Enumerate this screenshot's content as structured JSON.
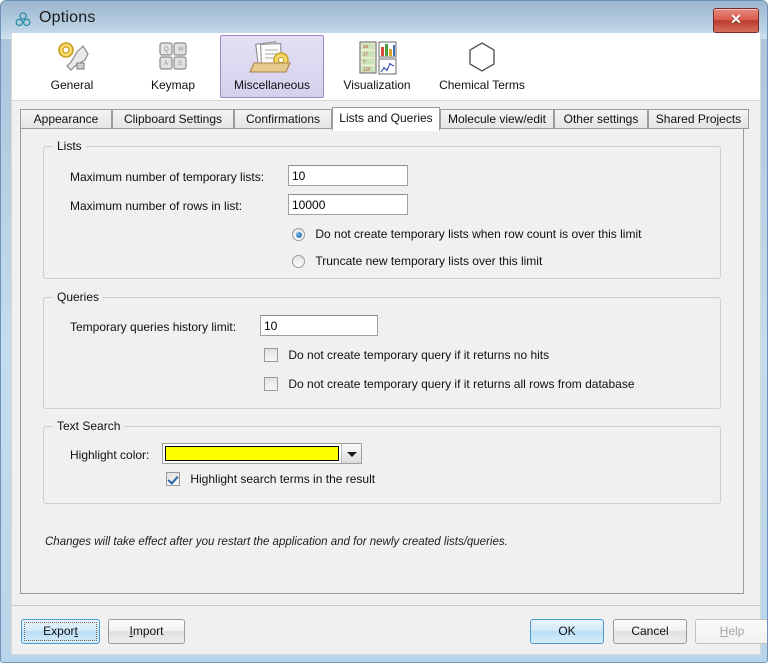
{
  "window": {
    "title": "Options",
    "title_icon": "molecule-icon",
    "close_label": "✕"
  },
  "toolbar": {
    "items": [
      {
        "label": "General",
        "icon": "gear-wrench-icon",
        "selected": false
      },
      {
        "label": "Keymap",
        "icon": "keyboard-keys-icon",
        "selected": false
      },
      {
        "label": "Miscellaneous",
        "icon": "documents-gear-icon",
        "selected": true
      },
      {
        "label": "Visualization",
        "icon": "charts-icon",
        "selected": false
      },
      {
        "label": "Chemical Terms",
        "icon": "benzene-ring-icon",
        "selected": false
      }
    ]
  },
  "tabs": [
    {
      "label": "Appearance",
      "active": false
    },
    {
      "label": "Clipboard Settings",
      "active": false
    },
    {
      "label": "Confirmations",
      "active": false
    },
    {
      "label": "Lists and Queries",
      "active": true
    },
    {
      "label": "Molecule view/edit",
      "active": false
    },
    {
      "label": "Other settings",
      "active": false
    },
    {
      "label": "Shared Projects",
      "active": false
    }
  ],
  "lists_group": {
    "title": "Lists",
    "max_temp_lists_label": "Maximum number of temporary lists:",
    "max_temp_lists_value": "10",
    "max_rows_label": "Maximum number of rows in list:",
    "max_rows_value": "10000",
    "radio_options": [
      {
        "label": "Do not create temporary lists when row count is over this limit",
        "selected": true
      },
      {
        "label": "Truncate new temporary lists over this limit",
        "selected": false
      }
    ]
  },
  "queries_group": {
    "title": "Queries",
    "history_limit_label": "Temporary queries history limit:",
    "history_limit_value": "10",
    "checkboxes": [
      {
        "label": "Do not create temporary query if it returns no hits",
        "checked": false
      },
      {
        "label": "Do not create temporary query if it returns all rows from database",
        "checked": false
      }
    ]
  },
  "text_search_group": {
    "title": "Text Search",
    "highlight_color_label": "Highlight color:",
    "highlight_color_value": "#FFFF00",
    "highlight_checkbox": {
      "label": "Highlight search terms in the result",
      "checked": true
    }
  },
  "note": "Changes will take effect after you restart the application and for newly created lists/queries.",
  "buttons": {
    "export": "Export",
    "import": "Import",
    "ok": "OK",
    "cancel": "Cancel",
    "help": "Help"
  },
  "colors": {
    "accent": "#4a9bd1",
    "highlight": "#FFFF00",
    "selected_tool": "#9b87c4",
    "titlebar": "#a8c0d6"
  }
}
